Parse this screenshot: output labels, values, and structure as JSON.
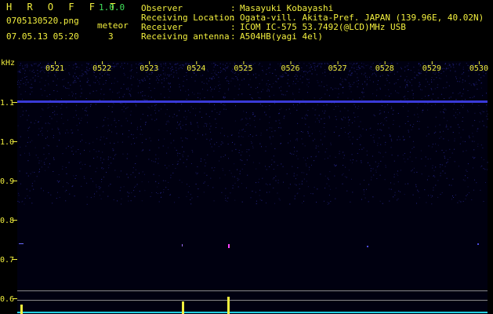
{
  "header": {
    "app_name": "H R O F F T",
    "version": "1.0.0",
    "filename": "0705130520.png",
    "meteor_label": "meteor",
    "meteor_count": "3",
    "datetime": "07.05.13 05:20"
  },
  "info": [
    {
      "label": "Observer",
      "value": "Masayuki Kobayashi"
    },
    {
      "label": "Receiving Location",
      "value": "Ogata-vill. Akita-Pref. JAPAN (139.96E, 40.02N)"
    },
    {
      "label": "Receiver",
      "value": "ICOM IC-575 53.7492(@LCD)MHz USB"
    },
    {
      "label": "Receiving antenna",
      "value": "A504HB(yagi 4el)"
    }
  ],
  "spectrogram": {
    "y_unit": "kHz",
    "y_ticks": [
      "1.1",
      "1.0",
      "0.9",
      "0.8",
      "0.7",
      "0.6"
    ],
    "x_ticks": [
      "0521",
      "0522",
      "0523",
      "0524",
      "0525",
      "0526",
      "0527",
      "0528",
      "0529",
      "0530"
    ],
    "colors": {
      "background": "#000010",
      "noise": "#2a2a9a",
      "carrier": "#3a3ad8",
      "axis_text": "#f2ef3e",
      "bar": "#f2ef3e",
      "baseline": "#22d0e0",
      "trace": "#ff40ff"
    }
  }
}
